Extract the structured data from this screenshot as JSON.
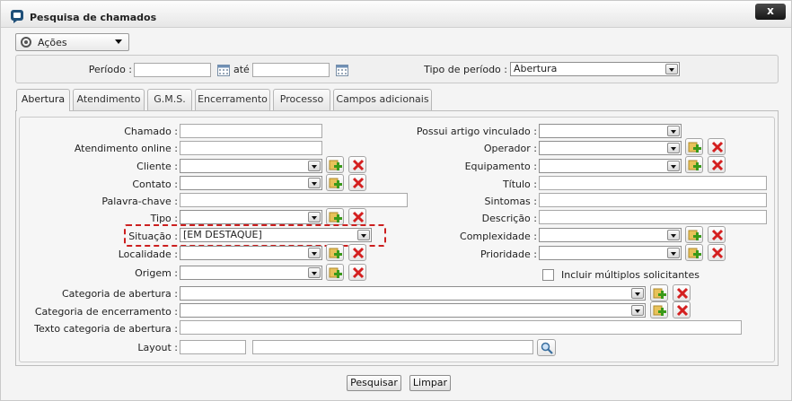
{
  "window": {
    "title": "Pesquisa de chamados",
    "close_label": "x"
  },
  "actions": {
    "label": "Ações"
  },
  "period": {
    "label": "Período :",
    "until_label": "até",
    "start_value": "",
    "end_value": "",
    "type_label": "Tipo de período :",
    "type_value": "Abertura"
  },
  "tabs": [
    {
      "label": "Abertura"
    },
    {
      "label": "Atendimento"
    },
    {
      "label": "G.M.S."
    },
    {
      "label": "Encerramento"
    },
    {
      "label": "Processo"
    },
    {
      "label": "Campos adicionais"
    }
  ],
  "fields": {
    "chamado": "Chamado :",
    "atendimento_online": "Atendimento online :",
    "cliente": "Cliente :",
    "contato": "Contato :",
    "palavra_chave": "Palavra-chave :",
    "tipo": "Tipo :",
    "situacao": "Situação :",
    "situacao_value": "[EM DESTAQUE]",
    "localidade": "Localidade :",
    "origem": "Origem :",
    "categoria_abertura": "Categoria de abertura :",
    "categoria_encerramento": "Categoria de encerramento :",
    "texto_categoria_abertura": "Texto categoria de abertura :",
    "layout": "Layout :",
    "possui_artigo": "Possui artigo vinculado :",
    "operador": "Operador :",
    "equipamento": "Equipamento :",
    "titulo": "Título :",
    "sintomas": "Sintomas :",
    "descricao": "Descrição :",
    "complexidade": "Complexidade :",
    "prioridade": "Prioridade :",
    "incluir_multiplos": "Incluir múltiplos solicitantes"
  },
  "buttons": {
    "search": "Pesquisar",
    "clear": "Limpar"
  },
  "icons": {
    "app": "chat-bubble-icon",
    "actions": "gear-icon",
    "calendar": "calendar-icon",
    "add": "add-icon",
    "remove": "remove-icon",
    "search": "magnifier-icon"
  },
  "colors": {
    "highlight": "#cc1f1f",
    "add": "#3a9a1a",
    "remove": "#d42020"
  }
}
